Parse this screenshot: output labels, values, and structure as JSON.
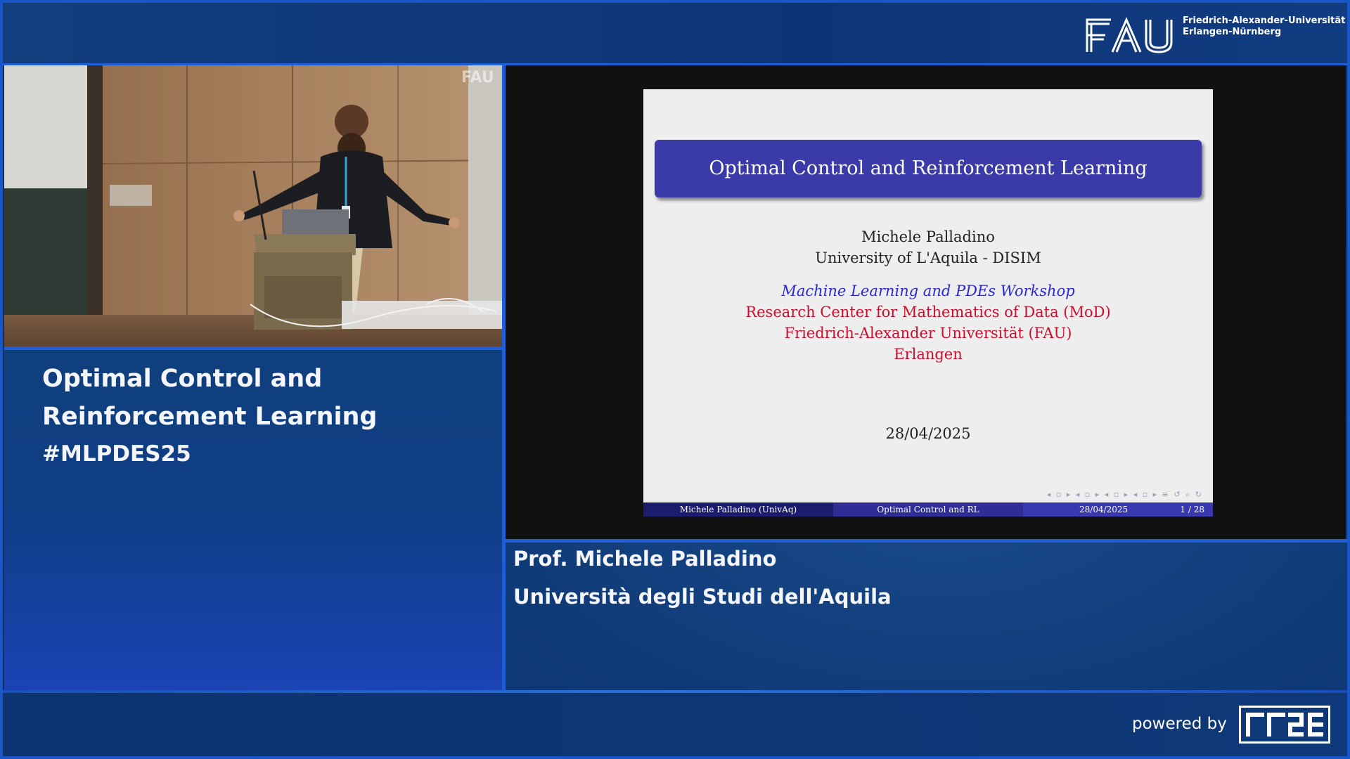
{
  "header": {
    "logo_text": "FAU",
    "university_line1": "Friedrich-Alexander-Universität",
    "university_line2": "Erlangen-Nürnberg"
  },
  "camera": {
    "watermark": "FAU"
  },
  "left_panel": {
    "title_line1": "Optimal Control and",
    "title_line2": "Reinforcement Learning",
    "hashtag": "#MLPDES25"
  },
  "slide": {
    "title": "Optimal Control and Reinforcement Learning",
    "author": "Michele Palladino",
    "affiliation": "University of L'Aquila - DISIM",
    "workshop": "Machine Learning and PDEs Workshop",
    "center": "Research Center for Mathematics of Data (MoD)",
    "university": "Friedrich-Alexander Universität (FAU)",
    "city": "Erlangen",
    "date": "28/04/2025",
    "footer": {
      "author": "Michele Palladino  (UnivAq)",
      "short_title": "Optimal Control and RL",
      "date": "28/04/2025",
      "page": "1 / 28"
    }
  },
  "speaker": {
    "name": "Prof. Michele Palladino",
    "institution": "Università degli Studi dell'Aquila"
  },
  "footer_bar": {
    "powered_by": "powered by",
    "logo_name": "rrze-logo"
  },
  "colors": {
    "accent_blue": "#1f5fd6",
    "slide_title_bg": "#3a3aa8",
    "slide_red": "#c8102e",
    "slide_blue_italic": "#2a2ad0"
  }
}
